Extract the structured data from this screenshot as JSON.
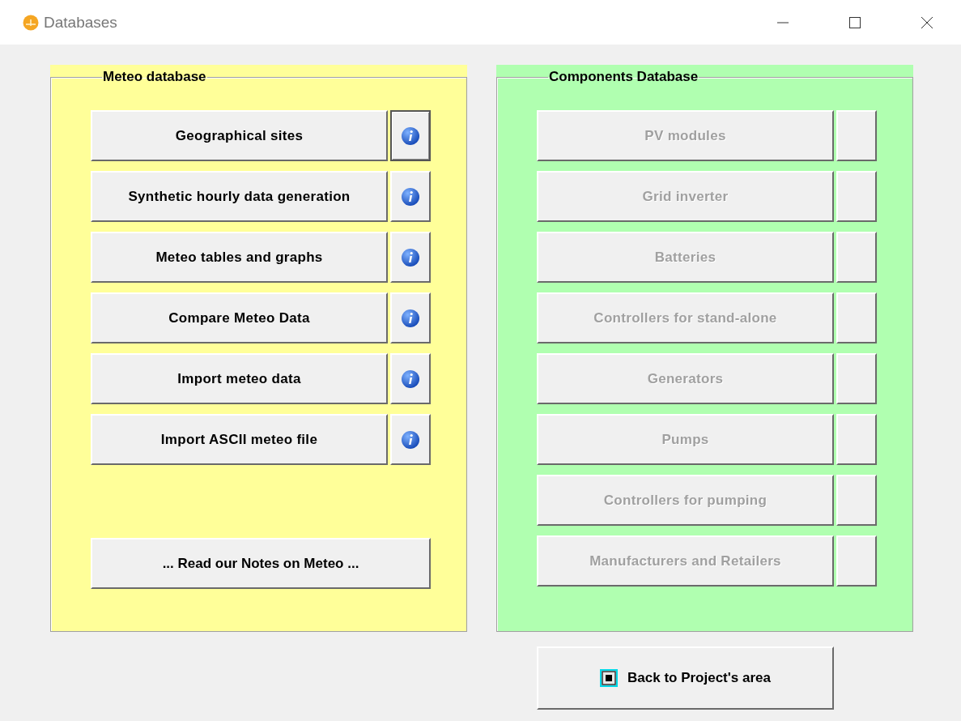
{
  "window": {
    "title": "Databases"
  },
  "meteo_database": {
    "title": "Meteo database",
    "items": [
      {
        "label": "Geographical sites",
        "info_pressed": true
      },
      {
        "label": "Synthetic hourly data generation",
        "info_pressed": false
      },
      {
        "label": "Meteo tables and graphs",
        "info_pressed": false
      },
      {
        "label": "Compare Meteo Data",
        "info_pressed": false
      },
      {
        "label": "Import meteo data",
        "info_pressed": false
      },
      {
        "label": "Import ASCII meteo file",
        "info_pressed": false
      }
    ],
    "notes_button": "... Read our Notes on Meteo ..."
  },
  "components_database": {
    "title": "Components Database",
    "items": [
      {
        "label": "PV modules",
        "disabled": true
      },
      {
        "label": "Grid inverter",
        "disabled": true
      },
      {
        "label": "Batteries",
        "disabled": true
      },
      {
        "label": "Controllers for stand-alone",
        "disabled": true
      },
      {
        "label": "Generators",
        "disabled": true
      },
      {
        "label": "Pumps",
        "disabled": true
      },
      {
        "label": "Controllers for pumping",
        "disabled": true
      },
      {
        "label": "Manufacturers and Retailers",
        "disabled": true
      }
    ]
  },
  "back_button": {
    "label": "Back to Project's area"
  }
}
